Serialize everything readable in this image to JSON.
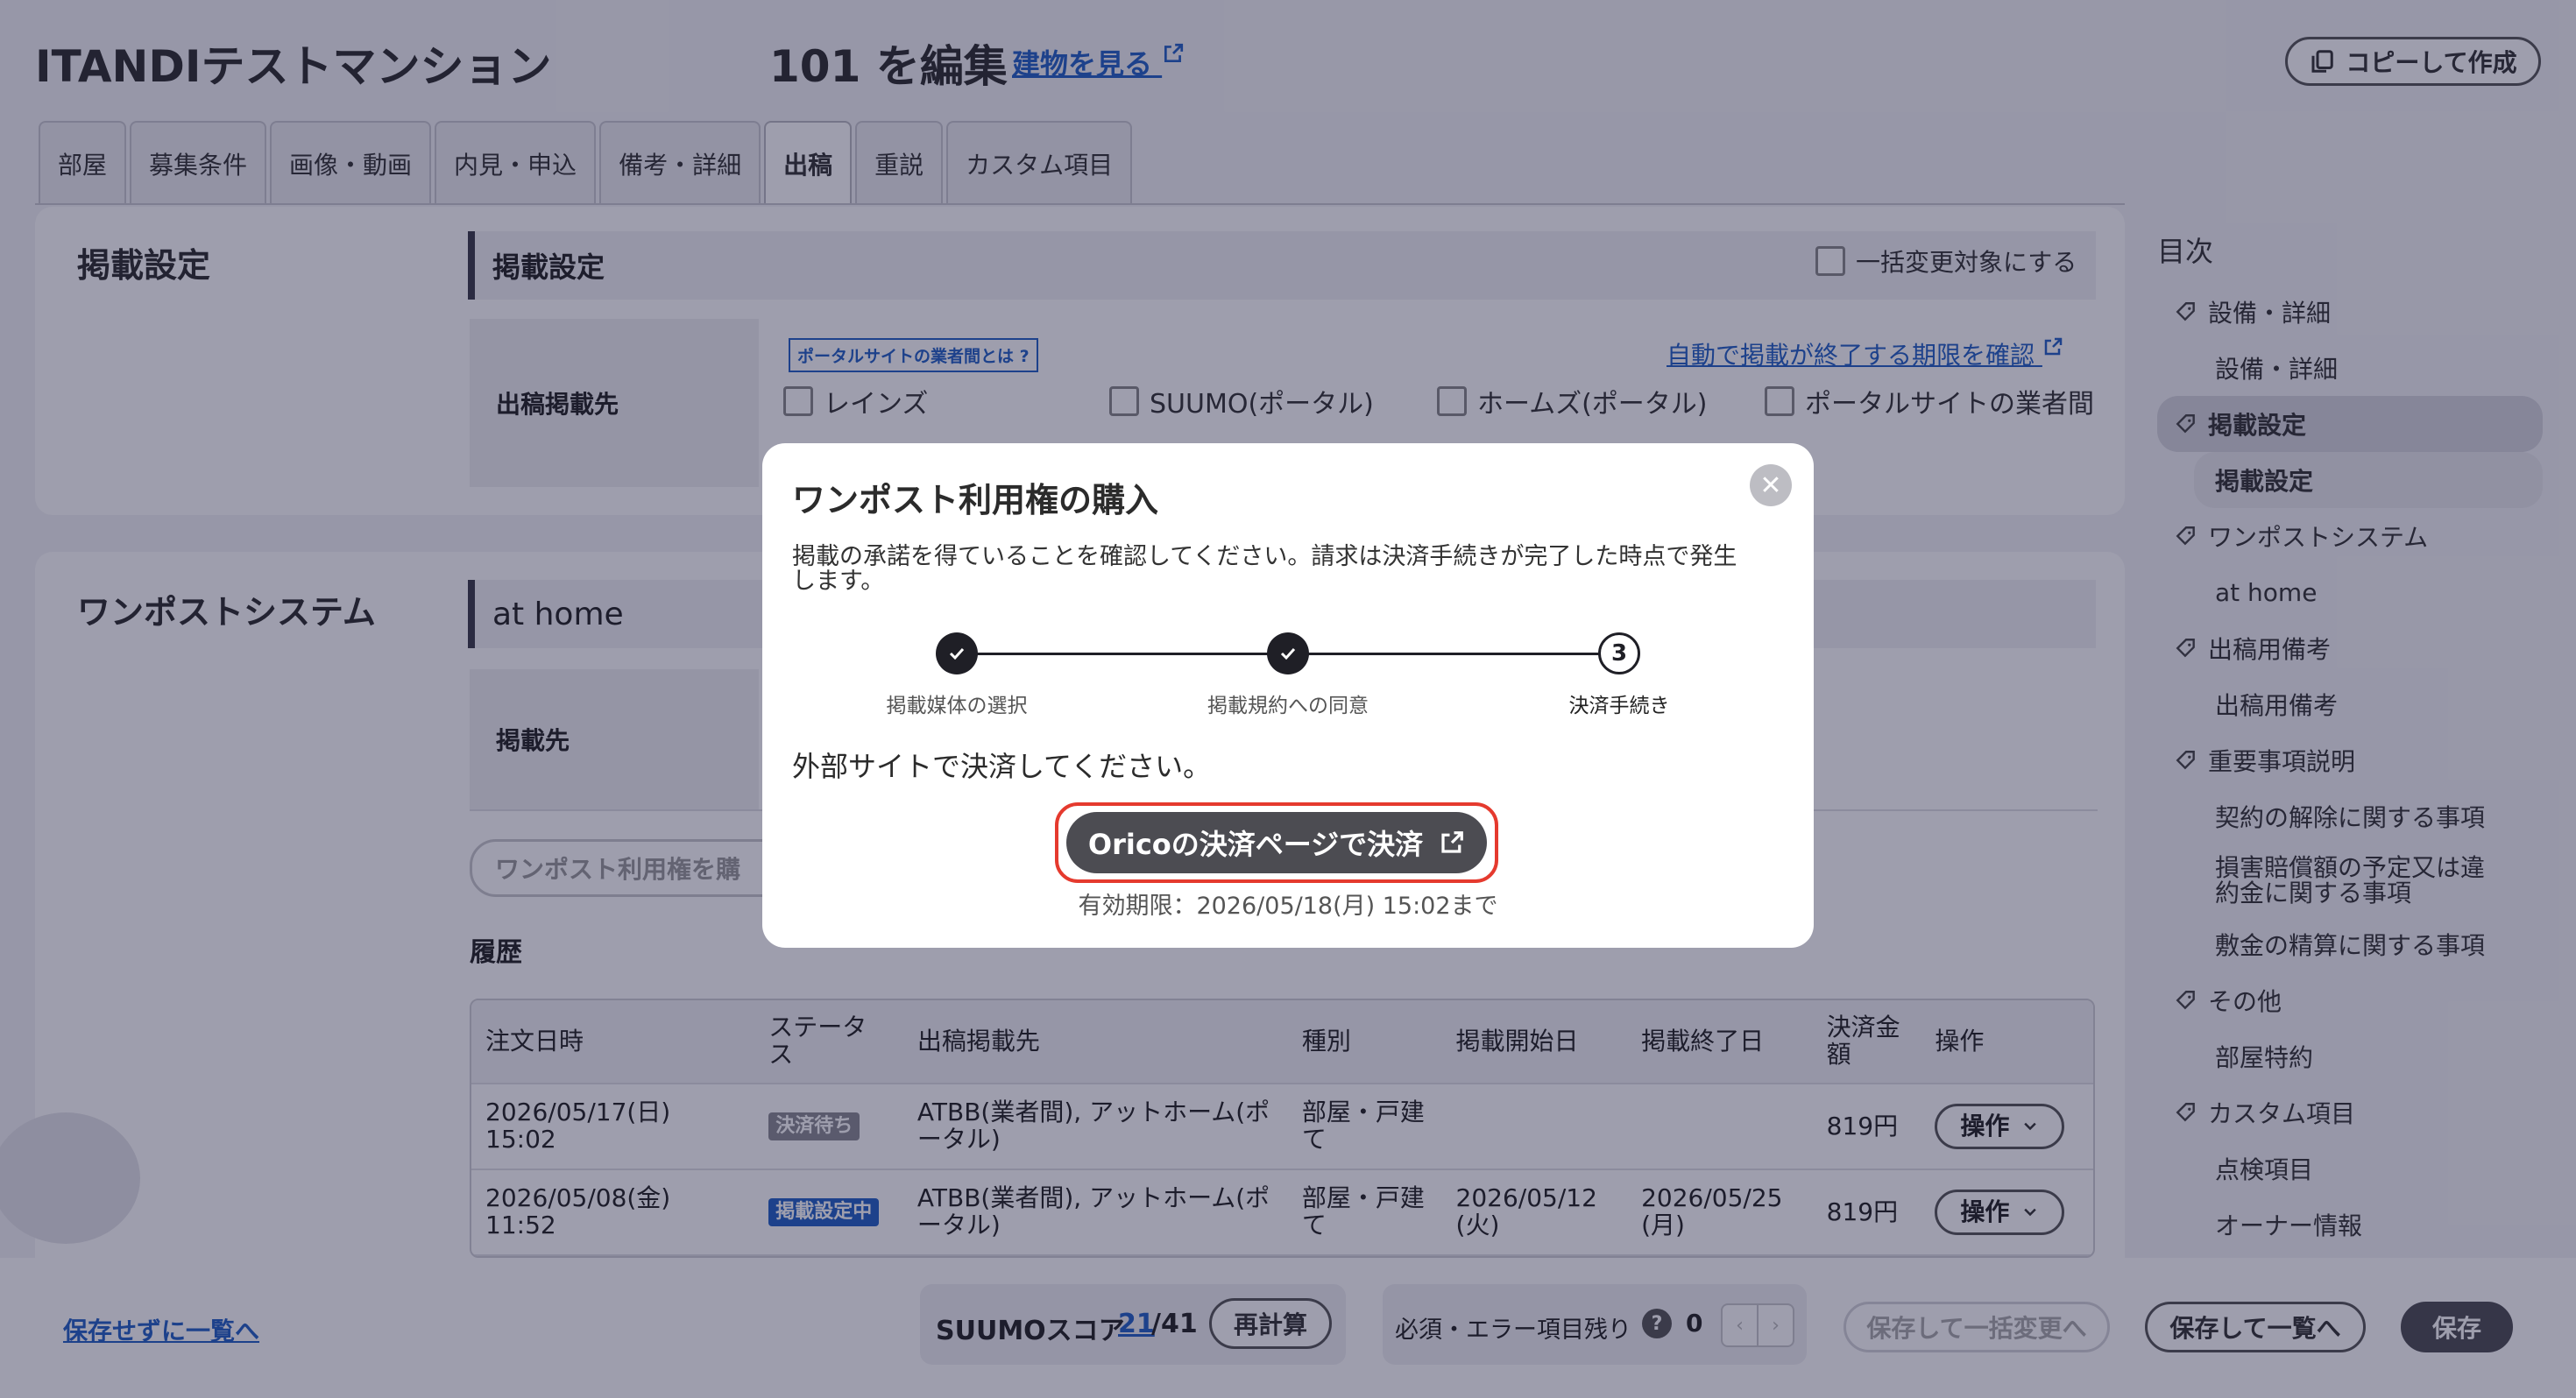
{
  "header": {
    "building_name": "ITANDIテストマンション",
    "room_title": "101 を編集",
    "view_building_link": "建物を見る",
    "copy_button": "コピーして作成"
  },
  "tabs": [
    {
      "label": "部屋"
    },
    {
      "label": "募集条件"
    },
    {
      "label": "画像・動画"
    },
    {
      "label": "内見・申込"
    },
    {
      "label": "備考・詳細"
    },
    {
      "label": "出稿"
    },
    {
      "label": "重説"
    },
    {
      "label": "カスタム項目"
    }
  ],
  "listing_section": {
    "title": "掲載設定",
    "bar_title": "掲載設定",
    "bulk_change_label": "一括変更対象にする",
    "portal_tag": "ポータルサイトの業者間とは",
    "auto_end_link": "自動で掲載が終了する期限を確認",
    "destination_label": "出稿掲載先",
    "options": [
      "レインズ",
      "SUUMO(ポータル)",
      "ホームズ(ポータル)",
      "ポータルサイトの業者間"
    ]
  },
  "onepost_section": {
    "title": "ワンポストシステム",
    "bar_title": "at home",
    "destination_label": "掲載先",
    "purchase_button": "ワンポスト利用権を購",
    "history_title": "履歴",
    "table": {
      "headers": [
        "注文日時",
        "ステータス",
        "出稿掲載先",
        "種別",
        "掲載開始日",
        "掲載終了日",
        "決済金額",
        "操作"
      ],
      "rows": [
        {
          "date": "2026/05/17(日)",
          "time": "15:02",
          "status": "決済待ち",
          "dest_line1": "ATBB(業者間), アットホーム(ポ",
          "dest_line2": "ータル)",
          "kind_line1": "部屋・戸建",
          "kind_line2": "て",
          "start_line1": "",
          "start_line2": "",
          "end_line1": "",
          "end_line2": "",
          "amount": "819円",
          "op": "操作"
        },
        {
          "date": "2026/05/08(金)",
          "time": "11:52",
          "status": "掲載設定中",
          "dest_line1": "ATBB(業者間), アットホーム(ポ",
          "dest_line2": "ータル)",
          "kind_line1": "部屋・戸建",
          "kind_line2": "て",
          "start_line1": "2026/05/12",
          "start_line2": "(火)",
          "end_line1": "2026/05/25",
          "end_line2": "(月)",
          "amount": "819円",
          "op": "操作"
        }
      ]
    }
  },
  "toc": {
    "title": "目次",
    "items": [
      {
        "label": "設備・詳細",
        "level": 1
      },
      {
        "label": "設備・詳細",
        "level": 2
      },
      {
        "label": "掲載設定",
        "level": 1,
        "active": true
      },
      {
        "label": "掲載設定",
        "level": 2,
        "active": true
      },
      {
        "label": "ワンポストシステム",
        "level": 1
      },
      {
        "label": "at home",
        "level": 2
      },
      {
        "label": "出稿用備考",
        "level": 1
      },
      {
        "label": "出稿用備考",
        "level": 2
      },
      {
        "label": "重要事項説明",
        "level": 1
      },
      {
        "label": "契約の解除に関する事項",
        "level": 2
      },
      {
        "label": "損害賠償額の予定又は違約金に関する事項",
        "level": 2
      },
      {
        "label": "敷金の精算に関する事項",
        "level": 2
      },
      {
        "label": "その他",
        "level": 1
      },
      {
        "label": "部屋特約",
        "level": 2
      },
      {
        "label": "カスタム項目",
        "level": 1
      },
      {
        "label": "点検項目",
        "level": 2
      },
      {
        "label": "オーナー情報",
        "level": 2
      }
    ]
  },
  "footer": {
    "back_link": "保存せずに一覧へ",
    "suumo_label": "SUUMOスコア",
    "suumo_score": "21",
    "suumo_total": "/41",
    "recalc_button": "再計算",
    "remaining_label": "必須・エラー項目残り",
    "remaining_count": "0",
    "save_bulk_button": "保存して一括変更へ",
    "save_list_button": "保存して一覧へ",
    "save_button": "保存"
  },
  "modal": {
    "title": "ワンポスト利用権の購入",
    "body_line1": "掲載の承諾を得ていることを確認してください。請求は決済手続きが完了した時点で発生",
    "body_line2": "します。",
    "steps": [
      {
        "label": "掲載媒体の選択",
        "state": "done"
      },
      {
        "label": "掲載規約への同意",
        "state": "done"
      },
      {
        "label": "決済手続き",
        "state": "current",
        "number": "3"
      }
    ],
    "instruction": "外部サイトで決済してください。",
    "pay_button": "Oricoの決済ページで決済",
    "expiry": "有効期限：2026/05/18(月) 15:02まで"
  },
  "colors": {
    "link": "#2160c4",
    "badge_waiting": "#8b8b92",
    "badge_active": "#2160c4",
    "highlight_border": "#e53a2e",
    "overlay": "#19193c"
  }
}
